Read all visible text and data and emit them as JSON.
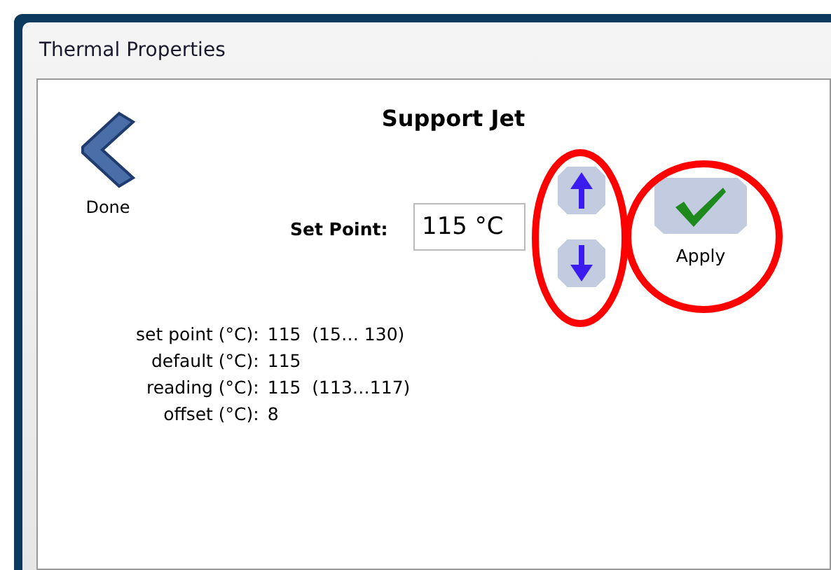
{
  "window": {
    "title": "Thermal Properties"
  },
  "back_button": {
    "label": "Done"
  },
  "heading": "Support Jet",
  "set_point": {
    "label": "Set Point:",
    "value": "115 °C"
  },
  "apply_button": {
    "label": "Apply"
  },
  "details": [
    {
      "label": "set point (°C):",
      "value": "115  (15… 130)"
    },
    {
      "label": "default (°C):",
      "value": "115"
    },
    {
      "label": "reading (°C):",
      "value": "115  (113…117)"
    },
    {
      "label": "offset (°C):",
      "value": "8"
    }
  ]
}
